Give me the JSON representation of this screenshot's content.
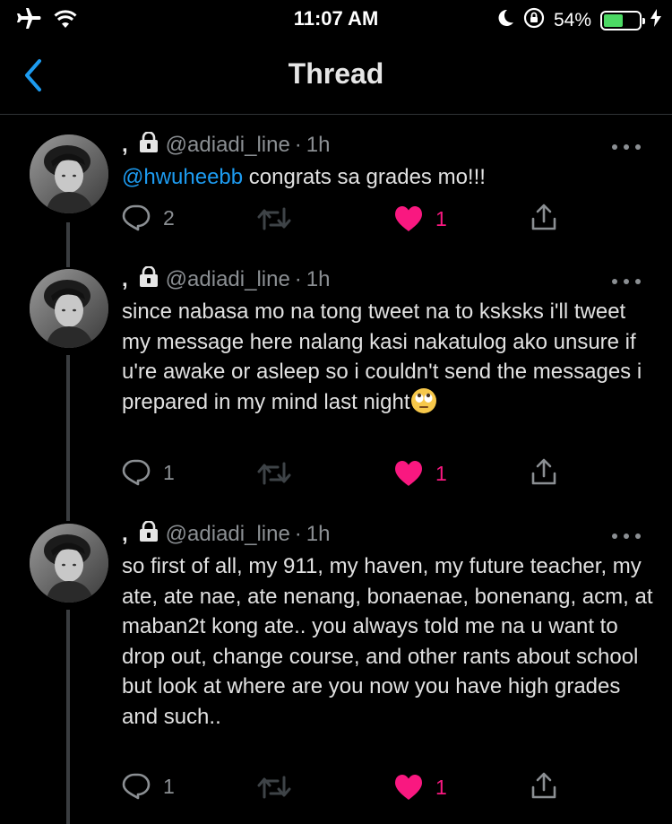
{
  "status_bar": {
    "time": "11:07 AM",
    "battery_percent": "54%",
    "battery_level": 0.54,
    "icons": [
      "airplane-icon",
      "wifi-icon",
      "moon-icon",
      "rotation-lock-icon",
      "battery-icon",
      "charging-bolt-icon"
    ]
  },
  "nav": {
    "title": "Thread",
    "back_icon": "chevron-left-icon"
  },
  "colors": {
    "accent": "#1d9bf0",
    "like": "#f91880",
    "background": "#000000",
    "muted": "#8b8f93"
  },
  "tweets": [
    {
      "comma": ",",
      "handle": "@adiadi_line",
      "sep": "·",
      "time": "1h",
      "mention": "@hwuheebb",
      "text": " congrats sa grades mo!!!",
      "replies": "2",
      "likes": "1"
    },
    {
      "comma": ",",
      "handle": "@adiadi_line",
      "sep": "·",
      "time": "1h",
      "text": "since nabasa mo na tong tweet na  to ksksks i'll tweet my message here nalang kasi nakatulog ako unsure if u're awake or asleep so i couldn't send the messages i prepared in my mind last night",
      "emoji": "face-with-rolling-eyes",
      "replies": "1",
      "likes": "1"
    },
    {
      "comma": ",",
      "handle": "@adiadi_line",
      "sep": "·",
      "time": "1h",
      "text": "so first of all, my 911, my haven, my future teacher, my ate, ate nae, ate nenang, bonaenae, bonenang, acm, at maban2t kong ate.. you always told me na u want to drop out, change course, and other rants about school but look at where are you now you have high grades and such..",
      "replies": "1",
      "likes": "1"
    }
  ]
}
